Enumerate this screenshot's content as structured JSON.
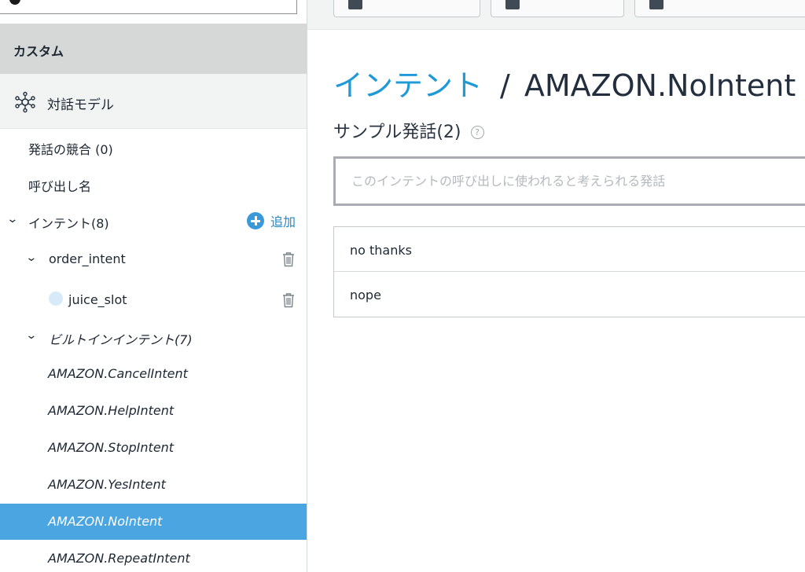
{
  "sidebar": {
    "section_header": "カスタム",
    "dialog_model": {
      "label": "対話モデル",
      "icon": "network-gear-icon"
    },
    "utterance_conflicts": "発話の競合 (0)",
    "invocation_name": "呼び出し名",
    "intents_label": "インテント(8)",
    "add_label": "追加",
    "custom_intent": "order_intent",
    "slot": "juice_slot",
    "builtin_label": "ビルトインインテント(7)",
    "builtin_intents": [
      "AMAZON.CancelIntent",
      "AMAZON.HelpIntent",
      "AMAZON.StopIntent",
      "AMAZON.YesIntent",
      "AMAZON.NoIntent",
      "AMAZON.RepeatIntent"
    ],
    "selected_intent": "AMAZON.NoIntent"
  },
  "main": {
    "breadcrumb_link": "インテント",
    "breadcrumb_sep": "/",
    "intent_name": "AMAZON.NoIntent",
    "sample_title": "サンプル発話(2)",
    "help_glyph": "?",
    "input_placeholder": "このインテントの呼び出しに使われると考えられる発話",
    "utterances": [
      "no thanks",
      "nope"
    ]
  },
  "colors": {
    "accent_link": "#1f9ad6",
    "selected_bg": "#4aa5e1",
    "header_bg": "#d6d8d8"
  }
}
